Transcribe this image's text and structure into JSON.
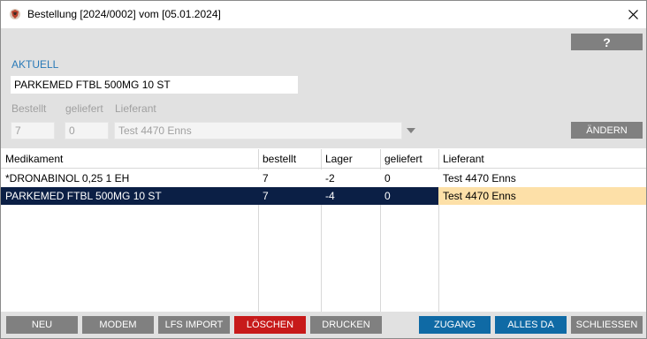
{
  "window": {
    "title": "Bestellung [2024/0002] vom [05.01.2024]"
  },
  "form": {
    "help_label": "?",
    "section_label": "AKTUELL",
    "product_value": "PARKEMED FTBL 500MG 10 ST",
    "labels": {
      "bestellt": "Bestellt",
      "geliefert": "geliefert",
      "lieferant": "Lieferant"
    },
    "values": {
      "bestellt": "7",
      "geliefert": "0",
      "lieferant": "Test  4470 Enns"
    },
    "change_label": "ÄNDERN"
  },
  "table": {
    "columns": [
      "Medikament",
      "bestellt",
      "Lager",
      "geliefert",
      "Lieferant"
    ],
    "rows": [
      [
        "*DRONABINOL 0,25 1 EH",
        "7",
        "-2",
        "0",
        "Test  4470 Enns"
      ],
      [
        "PARKEMED FTBL 500MG 10 ST",
        "7",
        "-4",
        "0",
        "Test  4470 Enns"
      ]
    ],
    "selected_row": 1
  },
  "buttons": {
    "neu": "NEU",
    "modem": "MODEM",
    "lfs_import": "LFS IMPORT",
    "loeschen": "LÖSCHEN",
    "drucken": "DRUCKEN",
    "zugang": "ZUGANG",
    "alles_da": "ALLES DA",
    "schliessen": "SCHLIESSEN"
  },
  "colors": {
    "accent_label": "#2a7ab8",
    "selected_row": "#0b1f45",
    "highlight_cell": "#fde0a8",
    "delete_button": "#c71a1a",
    "primary_button": "#0f6aa5",
    "neutral_button": "#808080"
  },
  "icons": {
    "app": "app-logo-icon",
    "close": "close-icon",
    "dropdown": "chevron-down-icon"
  }
}
